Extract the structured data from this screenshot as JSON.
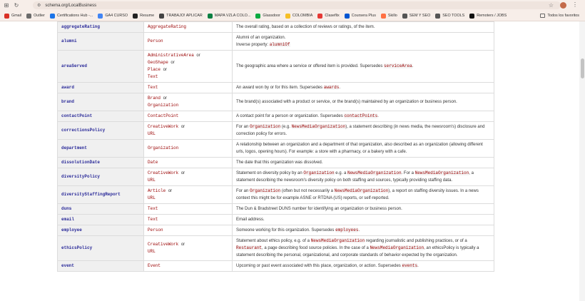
{
  "browser": {
    "url": "schema.org/LocalBusiness",
    "bookmarks": [
      {
        "label": "Gmail",
        "color": "#d93025"
      },
      {
        "label": "Outlier",
        "color": "#6b6b6b"
      },
      {
        "label": "Certifications Hub -...",
        "color": "#1a73e8"
      },
      {
        "label": "GA4 CURSO",
        "color": "#4285f4"
      },
      {
        "label": "Resume",
        "color": "#222222"
      },
      {
        "label": "TRABAJO! APLICAR",
        "color": "#444444"
      },
      {
        "label": "MAPA VZLA COLO...",
        "color": "#0b8043"
      },
      {
        "label": "Glassdoor",
        "color": "#0caa41"
      },
      {
        "label": "COLOMBIA",
        "color": "#f6bf26"
      },
      {
        "label": "Claseflix",
        "color": "#e53935"
      },
      {
        "label": "Coursera Plus",
        "color": "#0056d2"
      },
      {
        "label": "Skillo",
        "color": "#ff7043"
      },
      {
        "label": "SEM Y SEO",
        "color": "#555555"
      },
      {
        "label": "SEO TOOLS",
        "color": "#555555"
      },
      {
        "label": "Remoters / JOBS",
        "color": "#111111"
      }
    ],
    "all_bookmarks": "Todos los favoritos"
  },
  "table": {
    "rows": [
      {
        "prop": "aggregateRating",
        "types": [
          "AggregateRating"
        ],
        "desc": [
          {
            "t": "The overall rating, based on a collection of reviews or ratings, of the item."
          }
        ]
      },
      {
        "prop": "alumni",
        "types": [
          "Person"
        ],
        "desc": [
          {
            "t": "Alumni of an organization."
          },
          {
            "br": true
          },
          {
            "t": "Inverse property: "
          },
          {
            "c": "alumniOf"
          }
        ]
      },
      {
        "prop": "areaServed",
        "types": [
          "AdministrativeArea",
          "GeoShape",
          "Place",
          "Text"
        ],
        "desc": [
          {
            "t": "The geographic area where a service or offered item is provided. Supersedes "
          },
          {
            "c": "serviceArea"
          },
          {
            "t": "."
          }
        ]
      },
      {
        "prop": "award",
        "types": [
          "Text"
        ],
        "desc": [
          {
            "t": "An award won by or for this item. Supersedes "
          },
          {
            "c": "awards"
          },
          {
            "t": "."
          }
        ]
      },
      {
        "prop": "brand",
        "types": [
          "Brand",
          "Organization"
        ],
        "desc": [
          {
            "t": "The brand(s) associated with a product or service, or the brand(s) maintained by an organization or business person."
          }
        ]
      },
      {
        "prop": "contactPoint",
        "types": [
          "ContactPoint"
        ],
        "desc": [
          {
            "t": "A contact point for a person or organization. Supersedes "
          },
          {
            "c": "contactPoints"
          },
          {
            "t": "."
          }
        ]
      },
      {
        "prop": "correctionsPolicy",
        "types": [
          "CreativeWork",
          "URL"
        ],
        "desc": [
          {
            "t": "For an "
          },
          {
            "c": "Organization"
          },
          {
            "t": " (e.g. "
          },
          {
            "c": "NewsMediaOrganization"
          },
          {
            "t": "), a statement describing (in news media, the newsroom's) disclosure and correction policy for errors."
          }
        ]
      },
      {
        "prop": "department",
        "types": [
          "Organization"
        ],
        "desc": [
          {
            "t": "A relationship between an organization and a department of that organization, also described as an organization (allowing different urls, logos, opening hours). For example: a store with a pharmacy, or a bakery with a cafe."
          }
        ]
      },
      {
        "prop": "dissolutionDate",
        "types": [
          "Date"
        ],
        "desc": [
          {
            "t": "The date that this organization was dissolved."
          }
        ]
      },
      {
        "prop": "diversityPolicy",
        "types": [
          "CreativeWork",
          "URL"
        ],
        "desc": [
          {
            "t": "Statement on diversity policy by an "
          },
          {
            "c": "Organization"
          },
          {
            "t": " e.g. a "
          },
          {
            "c": "NewsMediaOrganization"
          },
          {
            "t": ". For a "
          },
          {
            "c": "NewsMediaOrganization"
          },
          {
            "t": ", a statement describing the newsroom's diversity policy on both staffing and sources, typically providing staffing data."
          }
        ]
      },
      {
        "prop": "diversityStaffingReport",
        "types": [
          "Article",
          "URL"
        ],
        "desc": [
          {
            "t": "For an "
          },
          {
            "c": "Organization"
          },
          {
            "t": " (often but not necessarily a "
          },
          {
            "c": "NewsMediaOrganization"
          },
          {
            "t": "), a report on staffing diversity issues. In a news context this might be for example ASNE or RTDNA (US) reports, or self-reported."
          }
        ]
      },
      {
        "prop": "duns",
        "types": [
          "Text"
        ],
        "desc": [
          {
            "t": "The Dun & Bradstreet DUNS number for identifying an organization or business person."
          }
        ]
      },
      {
        "prop": "email",
        "types": [
          "Text"
        ],
        "desc": [
          {
            "t": "Email address."
          }
        ]
      },
      {
        "prop": "employee",
        "types": [
          "Person"
        ],
        "desc": [
          {
            "t": "Someone working for this organization. Supersedes "
          },
          {
            "c": "employees"
          },
          {
            "t": "."
          }
        ]
      },
      {
        "prop": "ethicsPolicy",
        "types": [
          "CreativeWork",
          "URL"
        ],
        "desc": [
          {
            "t": "Statement about ethics policy, e.g. of a "
          },
          {
            "c": "NewsMediaOrganization"
          },
          {
            "t": " regarding journalistic and publishing practices, or of a "
          },
          {
            "c": "Restaurant"
          },
          {
            "t": ", a page describing food source policies. In the case of a "
          },
          {
            "c": "NewsMediaOrganization"
          },
          {
            "t": ", an ethicsPolicy is typically a statement describing the personal, organizational, and corporate standards of behavior expected by the organization."
          }
        ]
      },
      {
        "prop": "event",
        "types": [
          "Event"
        ],
        "desc": [
          {
            "t": "Upcoming or past event associated with this place, organization, or action. Supersedes "
          },
          {
            "c": "events"
          },
          {
            "t": "."
          }
        ]
      }
    ],
    "or_word": "or"
  }
}
